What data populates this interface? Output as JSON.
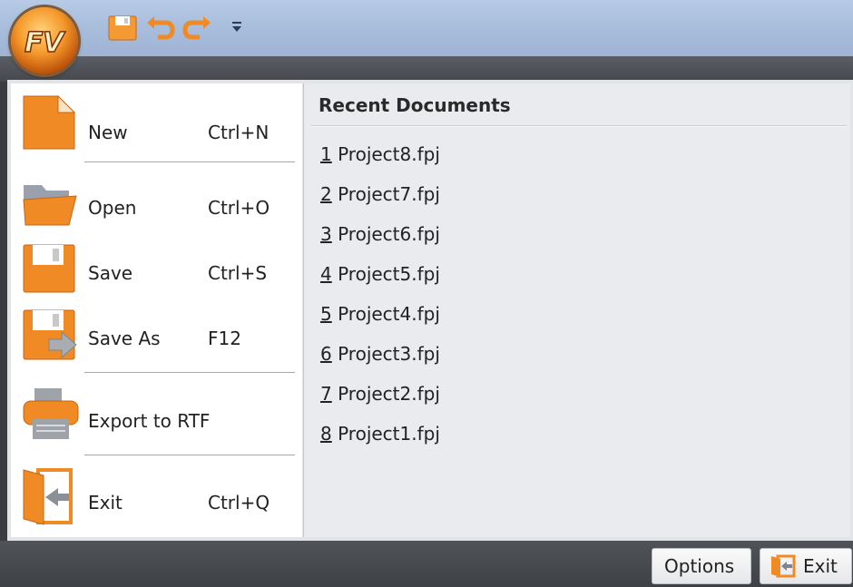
{
  "menu": {
    "commands": [
      {
        "label": "New",
        "shortcut": "Ctrl+N"
      },
      {
        "label": "Open",
        "shortcut": "Ctrl+O"
      },
      {
        "label": "Save",
        "shortcut": "Ctrl+S"
      },
      {
        "label": "Save As",
        "shortcut": "F12"
      },
      {
        "label": "Export to RTF",
        "shortcut": ""
      },
      {
        "label": "Exit",
        "shortcut": "Ctrl+Q"
      }
    ]
  },
  "recent": {
    "heading": "Recent Documents",
    "items": [
      {
        "num": "1",
        "name": " Project8.fpj"
      },
      {
        "num": "2",
        "name": " Project7.fpj"
      },
      {
        "num": "3",
        "name": " Project6.fpj"
      },
      {
        "num": "4",
        "name": " Project5.fpj"
      },
      {
        "num": "5",
        "name": " Project4.fpj"
      },
      {
        "num": "6",
        "name": " Project3.fpj"
      },
      {
        "num": "7",
        "name": " Project2.fpj"
      },
      {
        "num": "8",
        "name": " Project1.fpj"
      }
    ]
  },
  "footer": {
    "options_label": "Options",
    "exit_label": "Exit"
  },
  "colors": {
    "accent_orange": "#f08a24",
    "title_blue": "#a9bedd",
    "dark_bar": "#45484d"
  },
  "icons": {
    "app": "app-logo-icon",
    "qat": [
      "save-icon",
      "undo-icon",
      "redo-icon",
      "customize-dropdown-icon"
    ]
  }
}
